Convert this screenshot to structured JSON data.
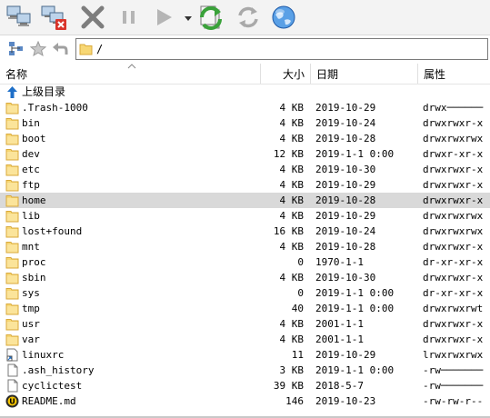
{
  "toolbar": {
    "buttons": [
      {
        "name": "connect-icon"
      },
      {
        "name": "disconnect-icon"
      },
      {
        "name": "cancel-icon"
      },
      {
        "name": "pause-icon"
      },
      {
        "name": "play-icon"
      },
      {
        "name": "dropdown-arrow-icon"
      },
      {
        "name": "transfer-icon"
      },
      {
        "name": "refresh-icon"
      },
      {
        "name": "globe-icon"
      }
    ]
  },
  "address": {
    "path": "/"
  },
  "columns": {
    "name": "名称",
    "size": "大小",
    "date": "日期",
    "attr": "属性"
  },
  "parent_dir_label": "上级目录",
  "selected_row": "home",
  "files": [
    {
      "name": ".Trash-1000",
      "size": "4 KB",
      "date": "2019-10-29",
      "attr": "drwx──────",
      "type": "folder"
    },
    {
      "name": "bin",
      "size": "4 KB",
      "date": "2019-10-24",
      "attr": "drwxrwxr-x",
      "type": "folder"
    },
    {
      "name": "boot",
      "size": "4 KB",
      "date": "2019-10-28",
      "attr": "drwxrwxrwx",
      "type": "folder"
    },
    {
      "name": "dev",
      "size": "12 KB",
      "date": "2019-1-1 0:00",
      "attr": "drwxr-xr-x",
      "type": "folder"
    },
    {
      "name": "etc",
      "size": "4 KB",
      "date": "2019-10-30",
      "attr": "drwxrwxr-x",
      "type": "folder"
    },
    {
      "name": "ftp",
      "size": "4 KB",
      "date": "2019-10-29",
      "attr": "drwxrwxr-x",
      "type": "folder"
    },
    {
      "name": "home",
      "size": "4 KB",
      "date": "2019-10-28",
      "attr": "drwxrwxr-x",
      "type": "folder"
    },
    {
      "name": "lib",
      "size": "4 KB",
      "date": "2019-10-29",
      "attr": "drwxrwxrwx",
      "type": "folder"
    },
    {
      "name": "lost+found",
      "size": "16 KB",
      "date": "2019-10-24",
      "attr": "drwxrwxrwx",
      "type": "folder"
    },
    {
      "name": "mnt",
      "size": "4 KB",
      "date": "2019-10-28",
      "attr": "drwxrwxr-x",
      "type": "folder"
    },
    {
      "name": "proc",
      "size": "0",
      "date": "1970-1-1",
      "attr": "dr-xr-xr-x",
      "type": "folder"
    },
    {
      "name": "sbin",
      "size": "4 KB",
      "date": "2019-10-30",
      "attr": "drwxrwxr-x",
      "type": "folder"
    },
    {
      "name": "sys",
      "size": "0",
      "date": "2019-1-1 0:00",
      "attr": "dr-xr-xr-x",
      "type": "folder"
    },
    {
      "name": "tmp",
      "size": "40",
      "date": "2019-1-1 0:00",
      "attr": "drwxrwxrwt",
      "type": "folder"
    },
    {
      "name": "usr",
      "size": "4 KB",
      "date": "2001-1-1",
      "attr": "drwxrwxr-x",
      "type": "folder"
    },
    {
      "name": "var",
      "size": "4 KB",
      "date": "2001-1-1",
      "attr": "drwxrwxr-x",
      "type": "folder"
    },
    {
      "name": "linuxrc",
      "size": "11",
      "date": "2019-10-29",
      "attr": "lrwxrwxrwx",
      "type": "link"
    },
    {
      "name": ".ash_history",
      "size": "3 KB",
      "date": "2019-1-1 0:00",
      "attr": "-rw───────",
      "type": "file"
    },
    {
      "name": "cyclictest",
      "size": "39 KB",
      "date": "2018-5-7",
      "attr": "-rw───────",
      "type": "file"
    },
    {
      "name": "README.md",
      "size": "146",
      "date": "2019-10-23",
      "attr": "-rw-rw-r--",
      "type": "md"
    }
  ],
  "colors": {
    "folder": "#f7d774",
    "folder_edge": "#d9a93a",
    "selected_row": "#d9d9d9",
    "arrow_blue": "#1e6fc8",
    "transfer_green": "#3aa23a",
    "cancel_gray": "#7d7d7d"
  }
}
